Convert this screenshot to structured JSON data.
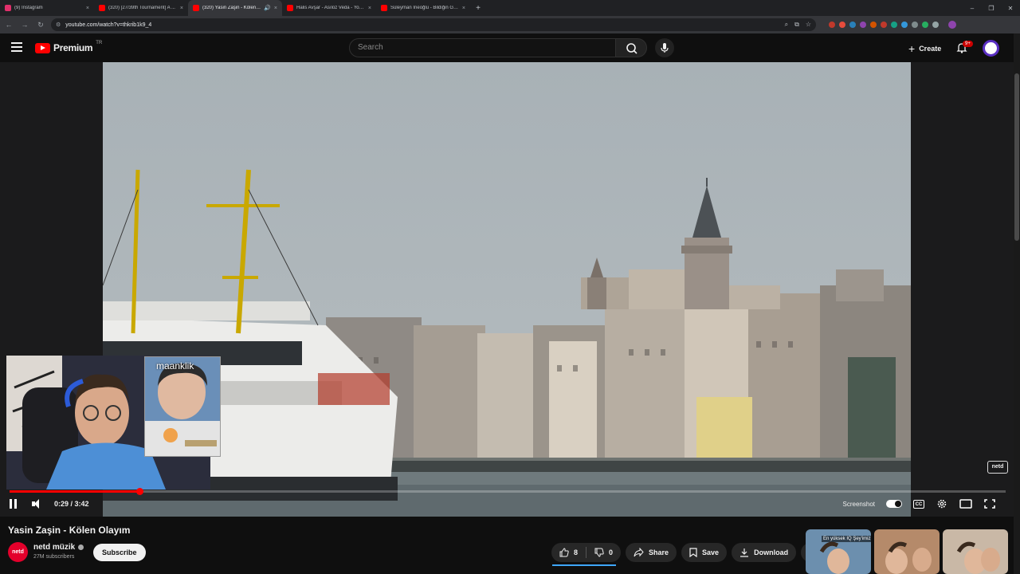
{
  "browser": {
    "tabs": [
      {
        "title": "(9) Instagram",
        "favicon_color": "#e1306c",
        "active": false,
        "audio": false
      },
      {
        "title": "(320) [27/39th Tournament] A ...",
        "favicon_color": "#ff0000",
        "active": false,
        "audio": false
      },
      {
        "title": "(320) Yasin Zaşin - Kölen Ol...",
        "favicon_color": "#ff0000",
        "active": true,
        "audio": true
      },
      {
        "title": "Halis Avşar - Asıloz Veda - YouT...",
        "favicon_color": "#ff0000",
        "active": false,
        "audio": false
      },
      {
        "title": "Süleyman İneoğlu - Bildiğin Gib...",
        "favicon_color": "#ff0000",
        "active": false,
        "audio": false
      }
    ],
    "close_glyph": "×",
    "new_tab_glyph": "+",
    "audio_glyph": "🔊",
    "window_controls": {
      "minimize": "–",
      "restore": "❐",
      "close": "✕"
    },
    "nav": {
      "back": "←",
      "forward": "→",
      "reload": "↻"
    },
    "url": "youtube.com/watch?v=thkrib1k9_4",
    "omnibox_icons": {
      "zoom": "⌕",
      "cast": "⧉",
      "star": "☆"
    },
    "extension_colors": [
      "#c0392b",
      "#e74c3c",
      "#2980b9",
      "#8e44ad",
      "#d35400",
      "#c0392b",
      "#16a085",
      "#3498db",
      "#7f8c8d",
      "#27ae60",
      "#95a5a6"
    ]
  },
  "youtube": {
    "brand": "Premium",
    "country": "TR",
    "search_placeholder": "Search",
    "create_label": "Create",
    "create_glyph": "+",
    "notification_count": "9+"
  },
  "player": {
    "current_time": "0:29",
    "duration": "3:42",
    "time_display": "0:29 / 3:42",
    "progress_fraction": 0.13,
    "screenshot_label": "Screenshot",
    "watermark": "netd",
    "stream_overlay_name": "maanklik",
    "cc_label": "CC"
  },
  "video": {
    "title": "Yasin Zaşin - Kölen Olayım",
    "channel_name": "netd müzik",
    "channel_avatar_text": "netd",
    "subscribers": "27M subscribers",
    "subscribe_label": "Subscribe",
    "likes": "8",
    "dislikes": "0",
    "share_label": "Share",
    "save_label": "Save",
    "download_label": "Download",
    "more_glyph": "•••"
  },
  "recommendations": [
    {
      "caption": "En yüksek IQ Şey'imiz",
      "bg": "#6c8fae"
    },
    {
      "caption": "",
      "bg": "#b58a6a"
    },
    {
      "caption": "",
      "bg": "#c9b8a6"
    }
  ]
}
